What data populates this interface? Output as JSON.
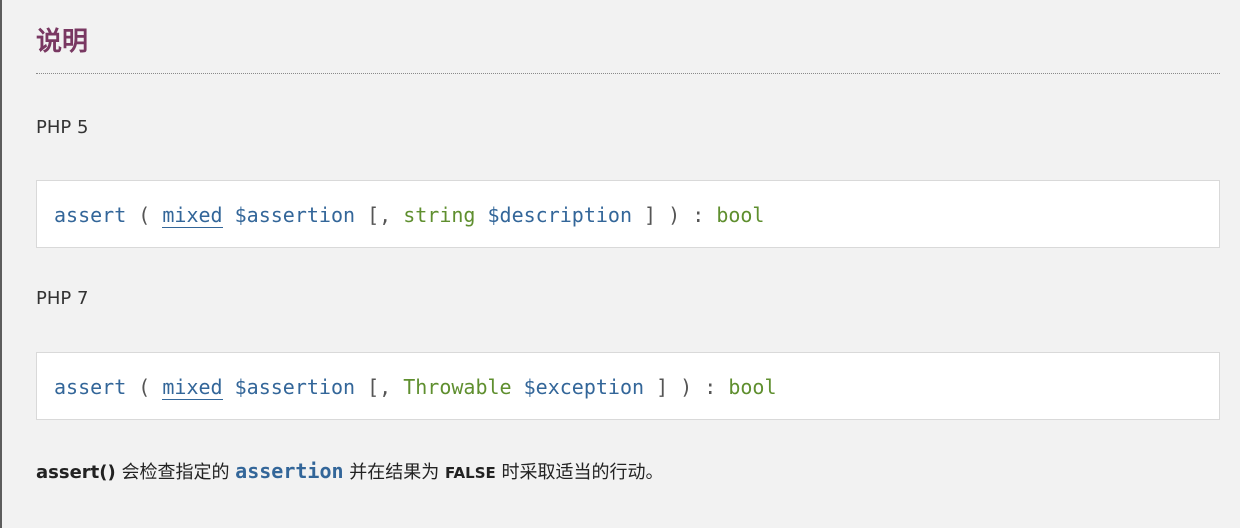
{
  "section": {
    "title": "说明"
  },
  "variants": [
    {
      "version_label": "PHP 5",
      "synopsis": {
        "function": "assert",
        "open_paren": " ( ",
        "param1_type": "mixed",
        "param1_name": " $assertion",
        "optional_open": " [, ",
        "param2_type": "string",
        "param2_name": " $description",
        "close": " ] ) : ",
        "return_type": "bool"
      }
    },
    {
      "version_label": "PHP 7",
      "synopsis": {
        "function": "assert",
        "open_paren": " ( ",
        "param1_type": "mixed",
        "param1_name": " $assertion",
        "optional_open": " [, ",
        "param2_type": "Throwable",
        "param2_name": " $exception",
        "close": " ] ) : ",
        "return_type": "bool"
      }
    }
  ],
  "description": {
    "function_ref": "assert()",
    "text1": " 会检查指定的 ",
    "param_ref": "assertion",
    "text2": " 并在结果为 ",
    "constant": "FALSE",
    "text3": " 时采取适当的行动。"
  },
  "colors": {
    "title": "#793862",
    "identifier": "#336699",
    "type": "#5f8f2f",
    "background": "#f2f2f2",
    "code_box": "#ffffff"
  }
}
